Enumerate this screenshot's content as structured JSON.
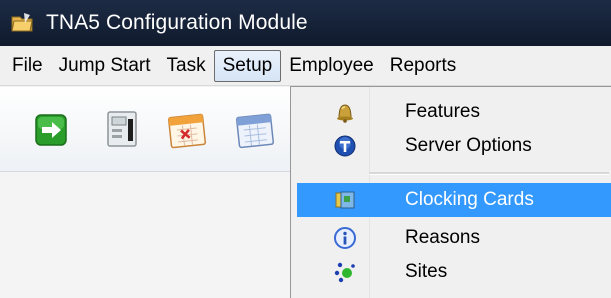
{
  "window": {
    "title": "TNA5 Configuration Module",
    "title_icon": "app-folder-icon"
  },
  "menubar": {
    "items": [
      {
        "label": "File"
      },
      {
        "label": "Jump Start"
      },
      {
        "label": "Task"
      },
      {
        "label": "Setup",
        "active": true
      },
      {
        "label": "Employee"
      },
      {
        "label": "Reports"
      }
    ]
  },
  "toolbar": {
    "buttons": [
      {
        "icon": "go-arrow-icon"
      },
      {
        "icon": "clocking-terminal-icon"
      },
      {
        "icon": "calendar-red-icon"
      },
      {
        "icon": "calendar-blue-icon"
      }
    ]
  },
  "setup_menu": {
    "items": [
      {
        "label": "Features",
        "icon": "bell-icon"
      },
      {
        "label": "Server Options",
        "icon": "server-t-icon"
      },
      {
        "label": "Clocking Cards",
        "icon": "card-icon",
        "highlighted": true
      },
      {
        "label": "Reasons",
        "icon": "info-icon"
      },
      {
        "label": "Sites",
        "icon": "sites-dots-icon"
      }
    ]
  },
  "colors": {
    "titlebar": "#14213a",
    "highlight": "#3399ff",
    "menu_bg": "#f0f0f0"
  }
}
